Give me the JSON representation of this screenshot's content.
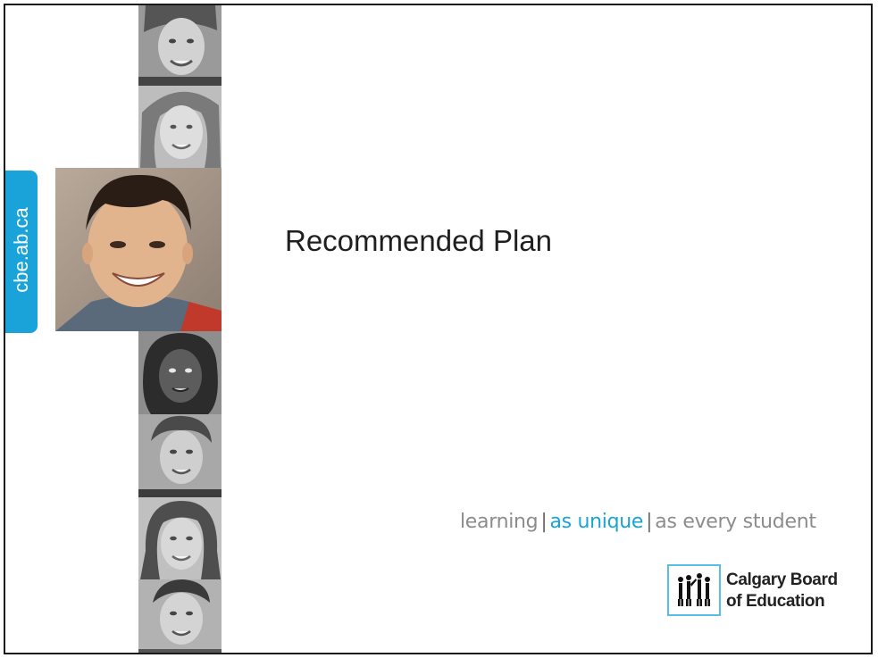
{
  "slide": {
    "side_tab_text": "cbe.ab.ca",
    "title": "Recommended Plan",
    "tagline": {
      "part1": "learning",
      "separator": "|",
      "part2": "as unique",
      "part3": "as every student"
    },
    "organization": {
      "line1": "Calgary Board",
      "line2": "of Education"
    }
  },
  "colors": {
    "accent_blue": "#1aa3d9",
    "tagline_gray": "#8c8c8c",
    "title_text": "#1f1f1f"
  },
  "icons": [
    "student-portrait-photo",
    "cbe-figures-logo-icon"
  ]
}
